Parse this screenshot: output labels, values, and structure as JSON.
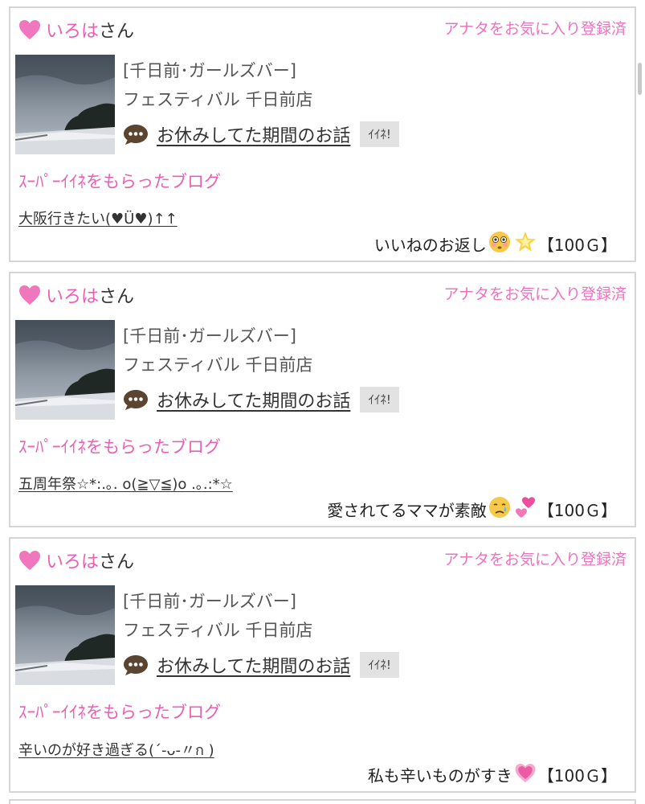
{
  "accent_pink": "#e960b4",
  "cards": [
    {
      "user_name": "いろは",
      "user_suffix": "さん",
      "fav_status": "アナタをお気に入り登録済",
      "shop_category": "[千日前･ガールズバー]",
      "shop_name": "フェスティバル 千日前店",
      "post_title": "お休みしてた期間のお話",
      "iine_label": "ｲｲﾈ!",
      "super_label": "ｽｰﾊﾟｰｲｲﾈをもらったブログ",
      "blog_title": "大阪行きたい(♥Ü♥)↑↑",
      "comment_text": "いいねのお返し",
      "comment_emojis": [
        "flushed-face",
        "glowing-star"
      ],
      "reward": "【100Ｇ】"
    },
    {
      "user_name": "いろは",
      "user_suffix": "さん",
      "fav_status": "アナタをお気に入り登録済",
      "shop_category": "[千日前･ガールズバー]",
      "shop_name": "フェスティバル 千日前店",
      "post_title": "お休みしてた期間のお話",
      "iine_label": "ｲｲﾈ!",
      "super_label": "ｽｰﾊﾟｰｲｲﾈをもらったブログ",
      "blog_title": "五周年祭☆*:.｡. o(≧▽≦)o .｡.:*☆",
      "comment_text": "愛されてるママが素敵",
      "comment_emojis": [
        "crying-face",
        "two-hearts"
      ],
      "reward": "【100Ｇ】"
    },
    {
      "user_name": "いろは",
      "user_suffix": "さん",
      "fav_status": "アナタをお気に入り登録済",
      "shop_category": "[千日前･ガールズバー]",
      "shop_name": "フェスティバル 千日前店",
      "post_title": "お休みしてた期間のお話",
      "iine_label": "ｲｲﾈ!",
      "super_label": "ｽｰﾊﾟｰｲｲﾈをもらったブログ",
      "blog_title": "辛いのが好き過ぎる(´-ᴗ-〃ก )",
      "comment_text": "私も辛いものがすき",
      "comment_emojis": [
        "growing-heart"
      ],
      "reward": "【100Ｇ】"
    }
  ]
}
